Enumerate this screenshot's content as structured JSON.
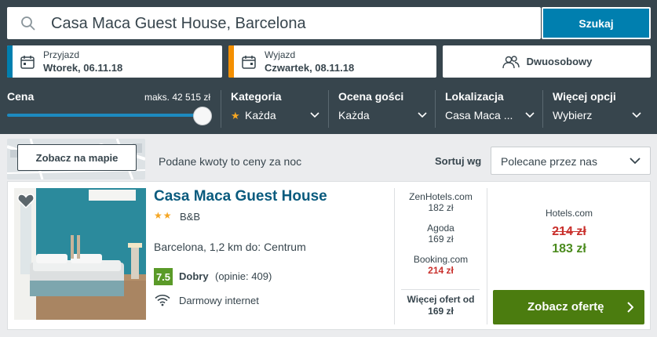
{
  "search": {
    "query": "Casa Maca Guest House, Barcelona",
    "button_label": "Szukaj"
  },
  "dates": {
    "checkin": {
      "label": "Przyjazd",
      "value": "Wtorek, 06.11.18",
      "accent": "#007faf"
    },
    "checkout": {
      "label": "Wyjazd",
      "value": "Czwartek, 08.11.18",
      "accent": "#f48f00"
    }
  },
  "room": {
    "label": "Dwuosobowy"
  },
  "filters": {
    "price": {
      "label": "Cena",
      "max_label": "maks. 42 515 zł",
      "level": 1.0
    },
    "category": {
      "label": "Kategoria",
      "value": "Każda"
    },
    "rating": {
      "label": "Ocena gości",
      "value": "Każda"
    },
    "location": {
      "label": "Lokalizacja",
      "value": "Casa Maca ..."
    },
    "more": {
      "label": "Więcej opcji",
      "value": "Wybierz"
    }
  },
  "toolbar": {
    "map_button": "Zobacz na mapie",
    "price_note": "Podane kwoty to ceny za noc",
    "sort_label": "Sortuj wg",
    "sort_value": "Polecane przez nas"
  },
  "hotel": {
    "name": "Casa Maca Guest House",
    "stars": "★★",
    "star_count": 2,
    "type": "B&B",
    "location": "Barcelona, 1,2 km do: Centrum",
    "rating_score": "7.5",
    "rating_word": "Dobry",
    "rating_count": "(opinie: 409)",
    "amenity": "Darmowy internet",
    "offers": [
      {
        "site": "ZenHotels.com",
        "price": "182 zł"
      },
      {
        "site": "Agoda",
        "price": "169 zł"
      },
      {
        "site": "Booking.com",
        "price": "214 zł"
      }
    ],
    "more_offers_label": "Więcej ofert od",
    "more_offers_price": "169 zł",
    "best": {
      "site": "Hotels.com",
      "old_price": "214 zł",
      "new_price": "183 zł"
    },
    "cta_label": "Zobacz ofertę"
  },
  "colors": {
    "header_bg": "#37454d",
    "primary": "#007faf",
    "cta": "#4b7c0f",
    "price_green": "#4b8b1e",
    "price_red": "#c9302c",
    "rating": "#5a9a28"
  }
}
